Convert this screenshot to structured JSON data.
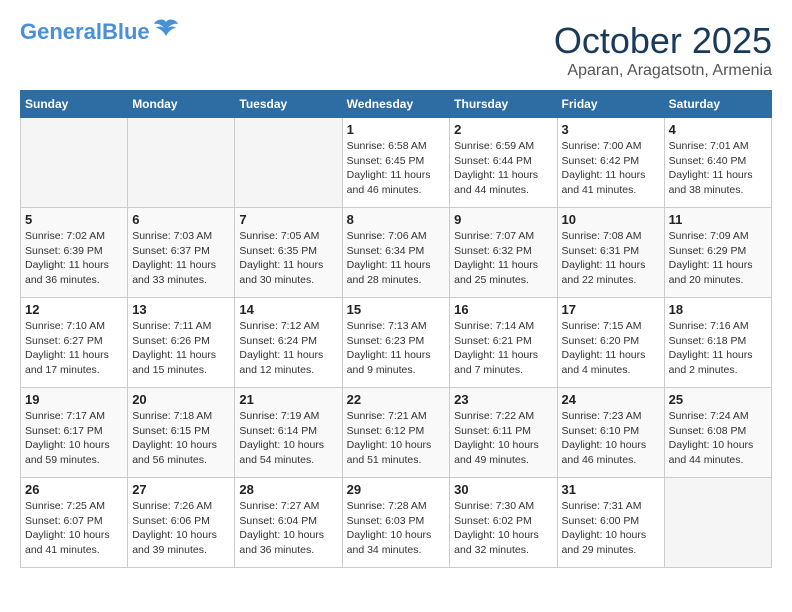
{
  "header": {
    "logo_general": "General",
    "logo_blue": "Blue",
    "title": "October 2025",
    "location": "Aparan, Aragatsotn, Armenia"
  },
  "weekdays": [
    "Sunday",
    "Monday",
    "Tuesday",
    "Wednesday",
    "Thursday",
    "Friday",
    "Saturday"
  ],
  "weeks": [
    [
      {
        "day": "",
        "sunrise": "",
        "sunset": "",
        "daylight": ""
      },
      {
        "day": "",
        "sunrise": "",
        "sunset": "",
        "daylight": ""
      },
      {
        "day": "",
        "sunrise": "",
        "sunset": "",
        "daylight": ""
      },
      {
        "day": "1",
        "sunrise": "Sunrise: 6:58 AM",
        "sunset": "Sunset: 6:45 PM",
        "daylight": "Daylight: 11 hours and 46 minutes."
      },
      {
        "day": "2",
        "sunrise": "Sunrise: 6:59 AM",
        "sunset": "Sunset: 6:44 PM",
        "daylight": "Daylight: 11 hours and 44 minutes."
      },
      {
        "day": "3",
        "sunrise": "Sunrise: 7:00 AM",
        "sunset": "Sunset: 6:42 PM",
        "daylight": "Daylight: 11 hours and 41 minutes."
      },
      {
        "day": "4",
        "sunrise": "Sunrise: 7:01 AM",
        "sunset": "Sunset: 6:40 PM",
        "daylight": "Daylight: 11 hours and 38 minutes."
      }
    ],
    [
      {
        "day": "5",
        "sunrise": "Sunrise: 7:02 AM",
        "sunset": "Sunset: 6:39 PM",
        "daylight": "Daylight: 11 hours and 36 minutes."
      },
      {
        "day": "6",
        "sunrise": "Sunrise: 7:03 AM",
        "sunset": "Sunset: 6:37 PM",
        "daylight": "Daylight: 11 hours and 33 minutes."
      },
      {
        "day": "7",
        "sunrise": "Sunrise: 7:05 AM",
        "sunset": "Sunset: 6:35 PM",
        "daylight": "Daylight: 11 hours and 30 minutes."
      },
      {
        "day": "8",
        "sunrise": "Sunrise: 7:06 AM",
        "sunset": "Sunset: 6:34 PM",
        "daylight": "Daylight: 11 hours and 28 minutes."
      },
      {
        "day": "9",
        "sunrise": "Sunrise: 7:07 AM",
        "sunset": "Sunset: 6:32 PM",
        "daylight": "Daylight: 11 hours and 25 minutes."
      },
      {
        "day": "10",
        "sunrise": "Sunrise: 7:08 AM",
        "sunset": "Sunset: 6:31 PM",
        "daylight": "Daylight: 11 hours and 22 minutes."
      },
      {
        "day": "11",
        "sunrise": "Sunrise: 7:09 AM",
        "sunset": "Sunset: 6:29 PM",
        "daylight": "Daylight: 11 hours and 20 minutes."
      }
    ],
    [
      {
        "day": "12",
        "sunrise": "Sunrise: 7:10 AM",
        "sunset": "Sunset: 6:27 PM",
        "daylight": "Daylight: 11 hours and 17 minutes."
      },
      {
        "day": "13",
        "sunrise": "Sunrise: 7:11 AM",
        "sunset": "Sunset: 6:26 PM",
        "daylight": "Daylight: 11 hours and 15 minutes."
      },
      {
        "day": "14",
        "sunrise": "Sunrise: 7:12 AM",
        "sunset": "Sunset: 6:24 PM",
        "daylight": "Daylight: 11 hours and 12 minutes."
      },
      {
        "day": "15",
        "sunrise": "Sunrise: 7:13 AM",
        "sunset": "Sunset: 6:23 PM",
        "daylight": "Daylight: 11 hours and 9 minutes."
      },
      {
        "day": "16",
        "sunrise": "Sunrise: 7:14 AM",
        "sunset": "Sunset: 6:21 PM",
        "daylight": "Daylight: 11 hours and 7 minutes."
      },
      {
        "day": "17",
        "sunrise": "Sunrise: 7:15 AM",
        "sunset": "Sunset: 6:20 PM",
        "daylight": "Daylight: 11 hours and 4 minutes."
      },
      {
        "day": "18",
        "sunrise": "Sunrise: 7:16 AM",
        "sunset": "Sunset: 6:18 PM",
        "daylight": "Daylight: 11 hours and 2 minutes."
      }
    ],
    [
      {
        "day": "19",
        "sunrise": "Sunrise: 7:17 AM",
        "sunset": "Sunset: 6:17 PM",
        "daylight": "Daylight: 10 hours and 59 minutes."
      },
      {
        "day": "20",
        "sunrise": "Sunrise: 7:18 AM",
        "sunset": "Sunset: 6:15 PM",
        "daylight": "Daylight: 10 hours and 56 minutes."
      },
      {
        "day": "21",
        "sunrise": "Sunrise: 7:19 AM",
        "sunset": "Sunset: 6:14 PM",
        "daylight": "Daylight: 10 hours and 54 minutes."
      },
      {
        "day": "22",
        "sunrise": "Sunrise: 7:21 AM",
        "sunset": "Sunset: 6:12 PM",
        "daylight": "Daylight: 10 hours and 51 minutes."
      },
      {
        "day": "23",
        "sunrise": "Sunrise: 7:22 AM",
        "sunset": "Sunset: 6:11 PM",
        "daylight": "Daylight: 10 hours and 49 minutes."
      },
      {
        "day": "24",
        "sunrise": "Sunrise: 7:23 AM",
        "sunset": "Sunset: 6:10 PM",
        "daylight": "Daylight: 10 hours and 46 minutes."
      },
      {
        "day": "25",
        "sunrise": "Sunrise: 7:24 AM",
        "sunset": "Sunset: 6:08 PM",
        "daylight": "Daylight: 10 hours and 44 minutes."
      }
    ],
    [
      {
        "day": "26",
        "sunrise": "Sunrise: 7:25 AM",
        "sunset": "Sunset: 6:07 PM",
        "daylight": "Daylight: 10 hours and 41 minutes."
      },
      {
        "day": "27",
        "sunrise": "Sunrise: 7:26 AM",
        "sunset": "Sunset: 6:06 PM",
        "daylight": "Daylight: 10 hours and 39 minutes."
      },
      {
        "day": "28",
        "sunrise": "Sunrise: 7:27 AM",
        "sunset": "Sunset: 6:04 PM",
        "daylight": "Daylight: 10 hours and 36 minutes."
      },
      {
        "day": "29",
        "sunrise": "Sunrise: 7:28 AM",
        "sunset": "Sunset: 6:03 PM",
        "daylight": "Daylight: 10 hours and 34 minutes."
      },
      {
        "day": "30",
        "sunrise": "Sunrise: 7:30 AM",
        "sunset": "Sunset: 6:02 PM",
        "daylight": "Daylight: 10 hours and 32 minutes."
      },
      {
        "day": "31",
        "sunrise": "Sunrise: 7:31 AM",
        "sunset": "Sunset: 6:00 PM",
        "daylight": "Daylight: 10 hours and 29 minutes."
      },
      {
        "day": "",
        "sunrise": "",
        "sunset": "",
        "daylight": ""
      }
    ]
  ]
}
